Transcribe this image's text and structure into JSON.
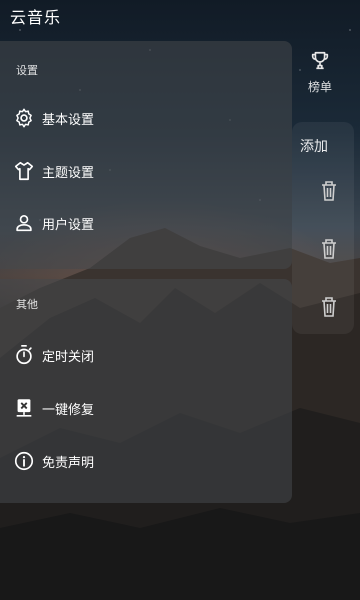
{
  "app": {
    "title": "云音乐"
  },
  "drawer": {
    "sections": [
      {
        "title": "设置",
        "items": [
          {
            "label": "基本设置",
            "icon": "gear-icon"
          },
          {
            "label": "主题设置",
            "icon": "shirt-icon"
          },
          {
            "label": "用户设置",
            "icon": "user-icon"
          }
        ]
      },
      {
        "title": "其他",
        "items": [
          {
            "label": "定时关闭",
            "icon": "timer-icon"
          },
          {
            "label": "一键修复",
            "icon": "repair-icon"
          },
          {
            "label": "免责声明",
            "icon": "info-icon"
          }
        ]
      }
    ]
  },
  "background_page": {
    "rank_label": "榜单",
    "add_label": "添加"
  }
}
